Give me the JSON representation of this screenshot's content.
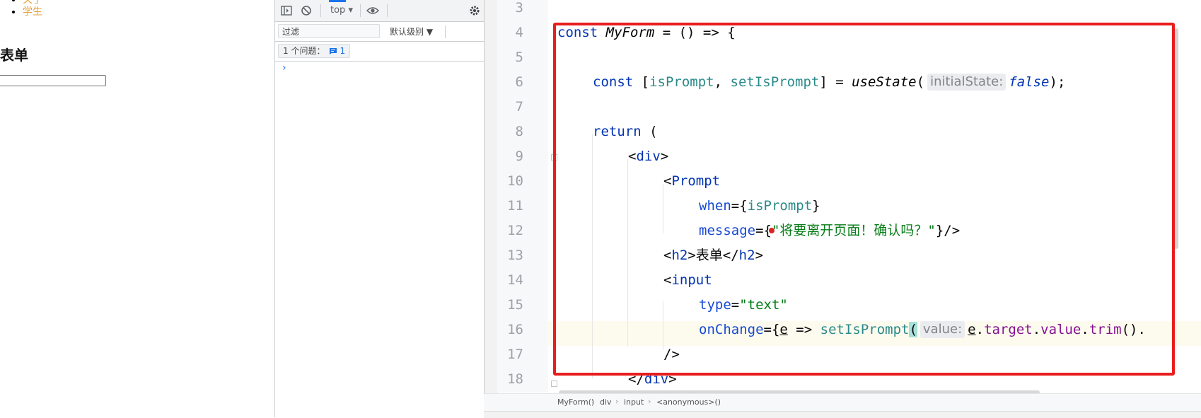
{
  "page": {
    "nav_items": [
      "关于",
      "学生"
    ],
    "form_title": "表单"
  },
  "devtools": {
    "context": "top",
    "filter_placeholder": "过滤",
    "level": "默认级别 ▼",
    "issues_label": "1 个问题：",
    "issues_count": "1",
    "prompt_symbol": "›"
  },
  "editor": {
    "line_numbers": [
      "3",
      "4",
      "5",
      "6",
      "7",
      "8",
      "9",
      "10",
      "11",
      "12",
      "13",
      "14",
      "15",
      "16",
      "17",
      "18"
    ],
    "hints": {
      "initial_state": "initialState:",
      "value": "value:"
    },
    "breadcrumb": [
      "MyForm()",
      "div",
      "input",
      "<anonymous>()"
    ]
  },
  "colors": {
    "annotation": "#e81e1e",
    "link": "#e6a23c",
    "current_line": "#fdfbee"
  }
}
